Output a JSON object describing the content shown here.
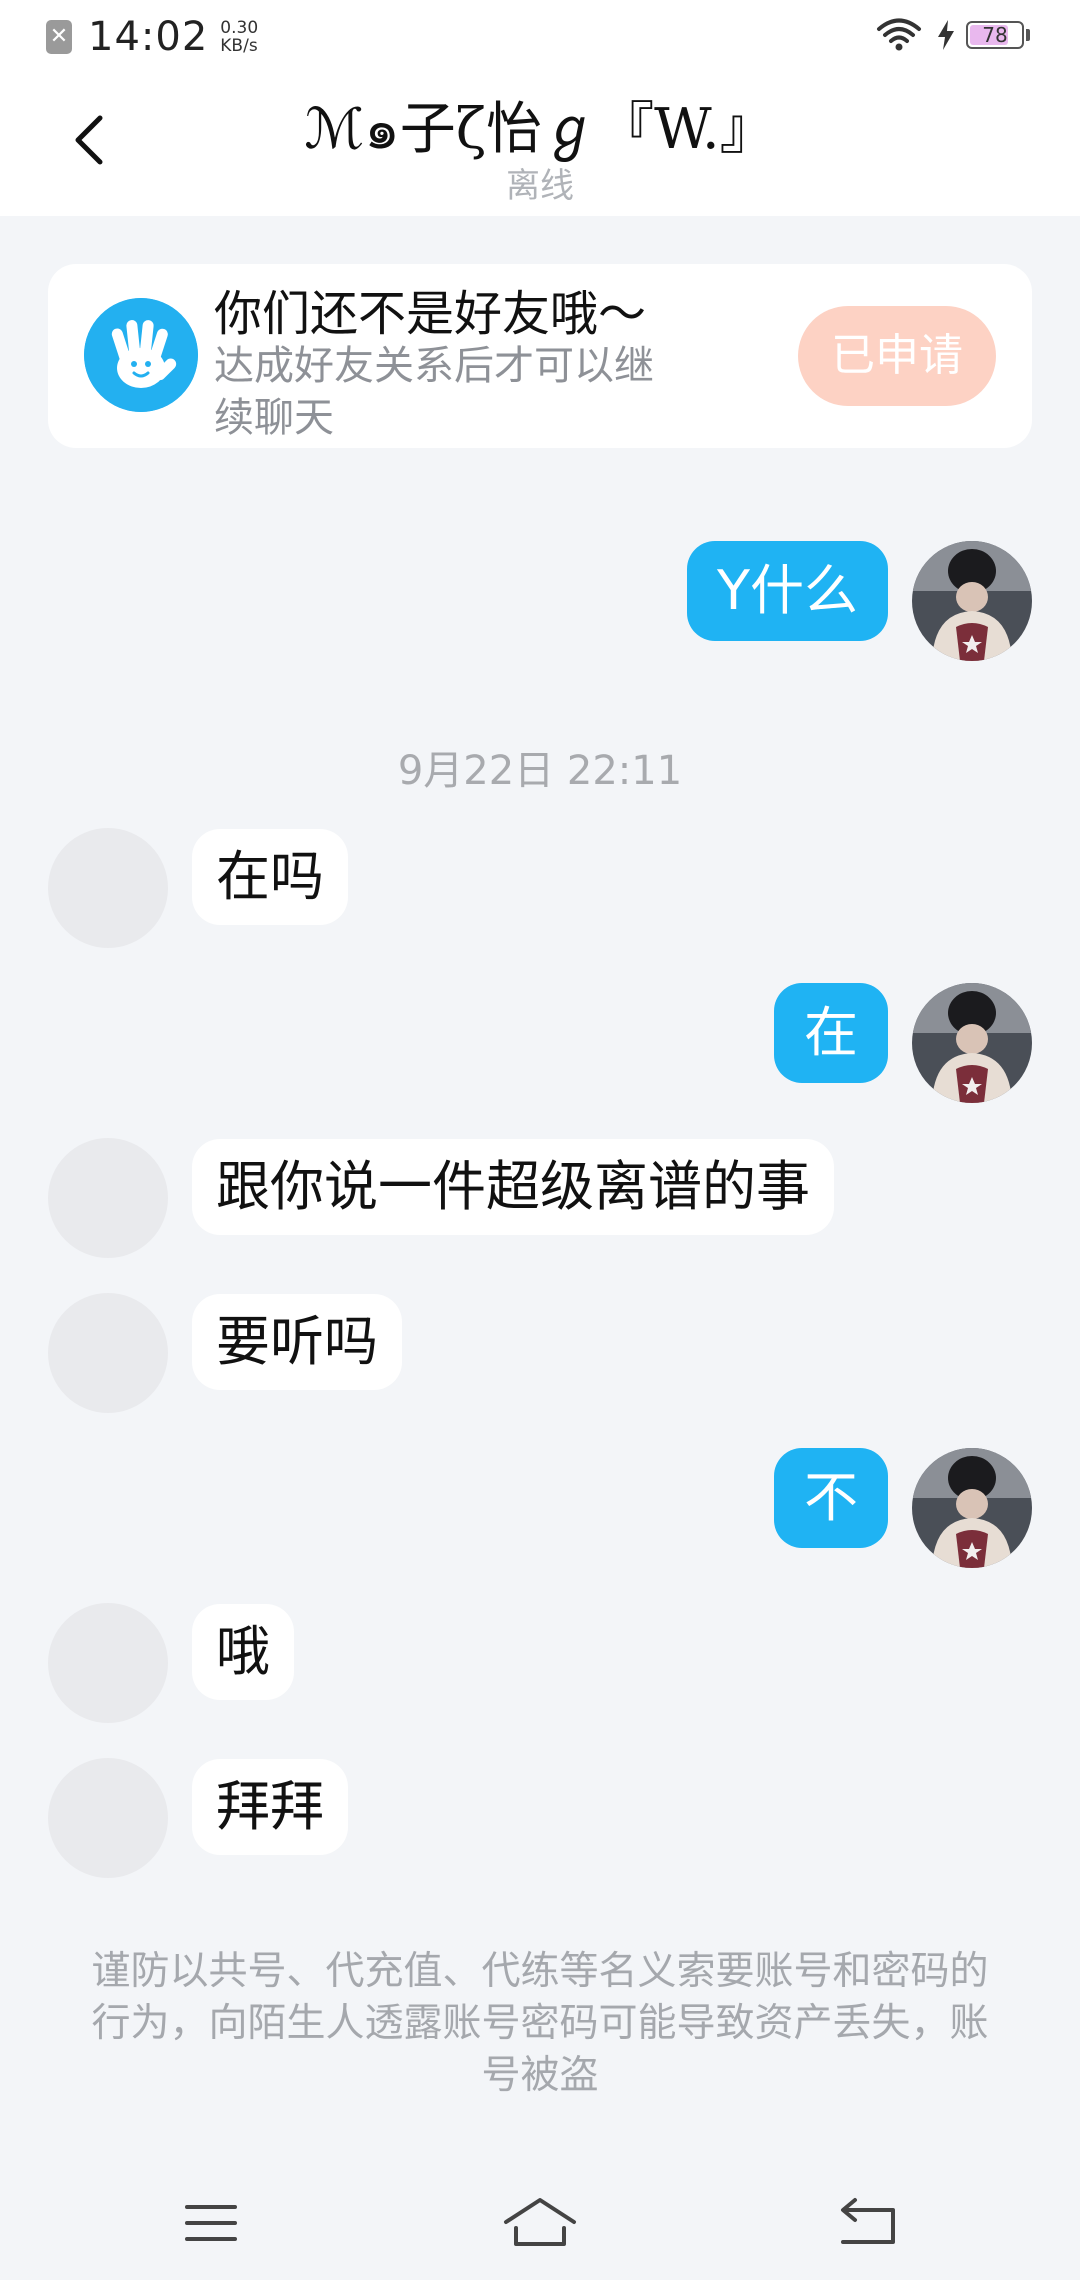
{
  "status_bar": {
    "time": "14:02",
    "net_speed_value": "0.30",
    "net_speed_unit": "KB/s",
    "battery_level": "78",
    "battery_fraction": 0.78,
    "notification_icon": "close-box-icon"
  },
  "header": {
    "title": "ℳ๑子ζ怡ℊ『W.』",
    "status": "离线",
    "back_icon": "chevron-left-icon"
  },
  "friend_card": {
    "title": "你们还不是好友哦～",
    "description": "达成好友关系后才可以继续聊天",
    "button_label": "已申请",
    "icon": "waving-hand-icon"
  },
  "messages": [
    {
      "sender": "me",
      "text": "Y什么"
    },
    {
      "type": "timestamp",
      "text": "9月22日 22:11"
    },
    {
      "sender": "other",
      "text": "在吗"
    },
    {
      "sender": "me",
      "text": "在"
    },
    {
      "sender": "other",
      "text": "跟你说一件超级离谱的事"
    },
    {
      "sender": "other",
      "text": "要听吗"
    },
    {
      "sender": "me",
      "text": "不"
    },
    {
      "sender": "other",
      "text": "哦"
    },
    {
      "sender": "other",
      "text": "拜拜"
    }
  ],
  "notice": "谨防以共号、代充值、代练等名义索要账号和密码的行为，向陌生人透露账号密码可能导致资产丢失，账号被盗",
  "nav_bar": {
    "menu_icon": "menu-icon",
    "home_icon": "home-icon",
    "back_icon": "back-icon"
  },
  "colors": {
    "accent": "#1fb3f3",
    "background": "#f3f5f8",
    "applied_button": "#fdd2c4"
  }
}
